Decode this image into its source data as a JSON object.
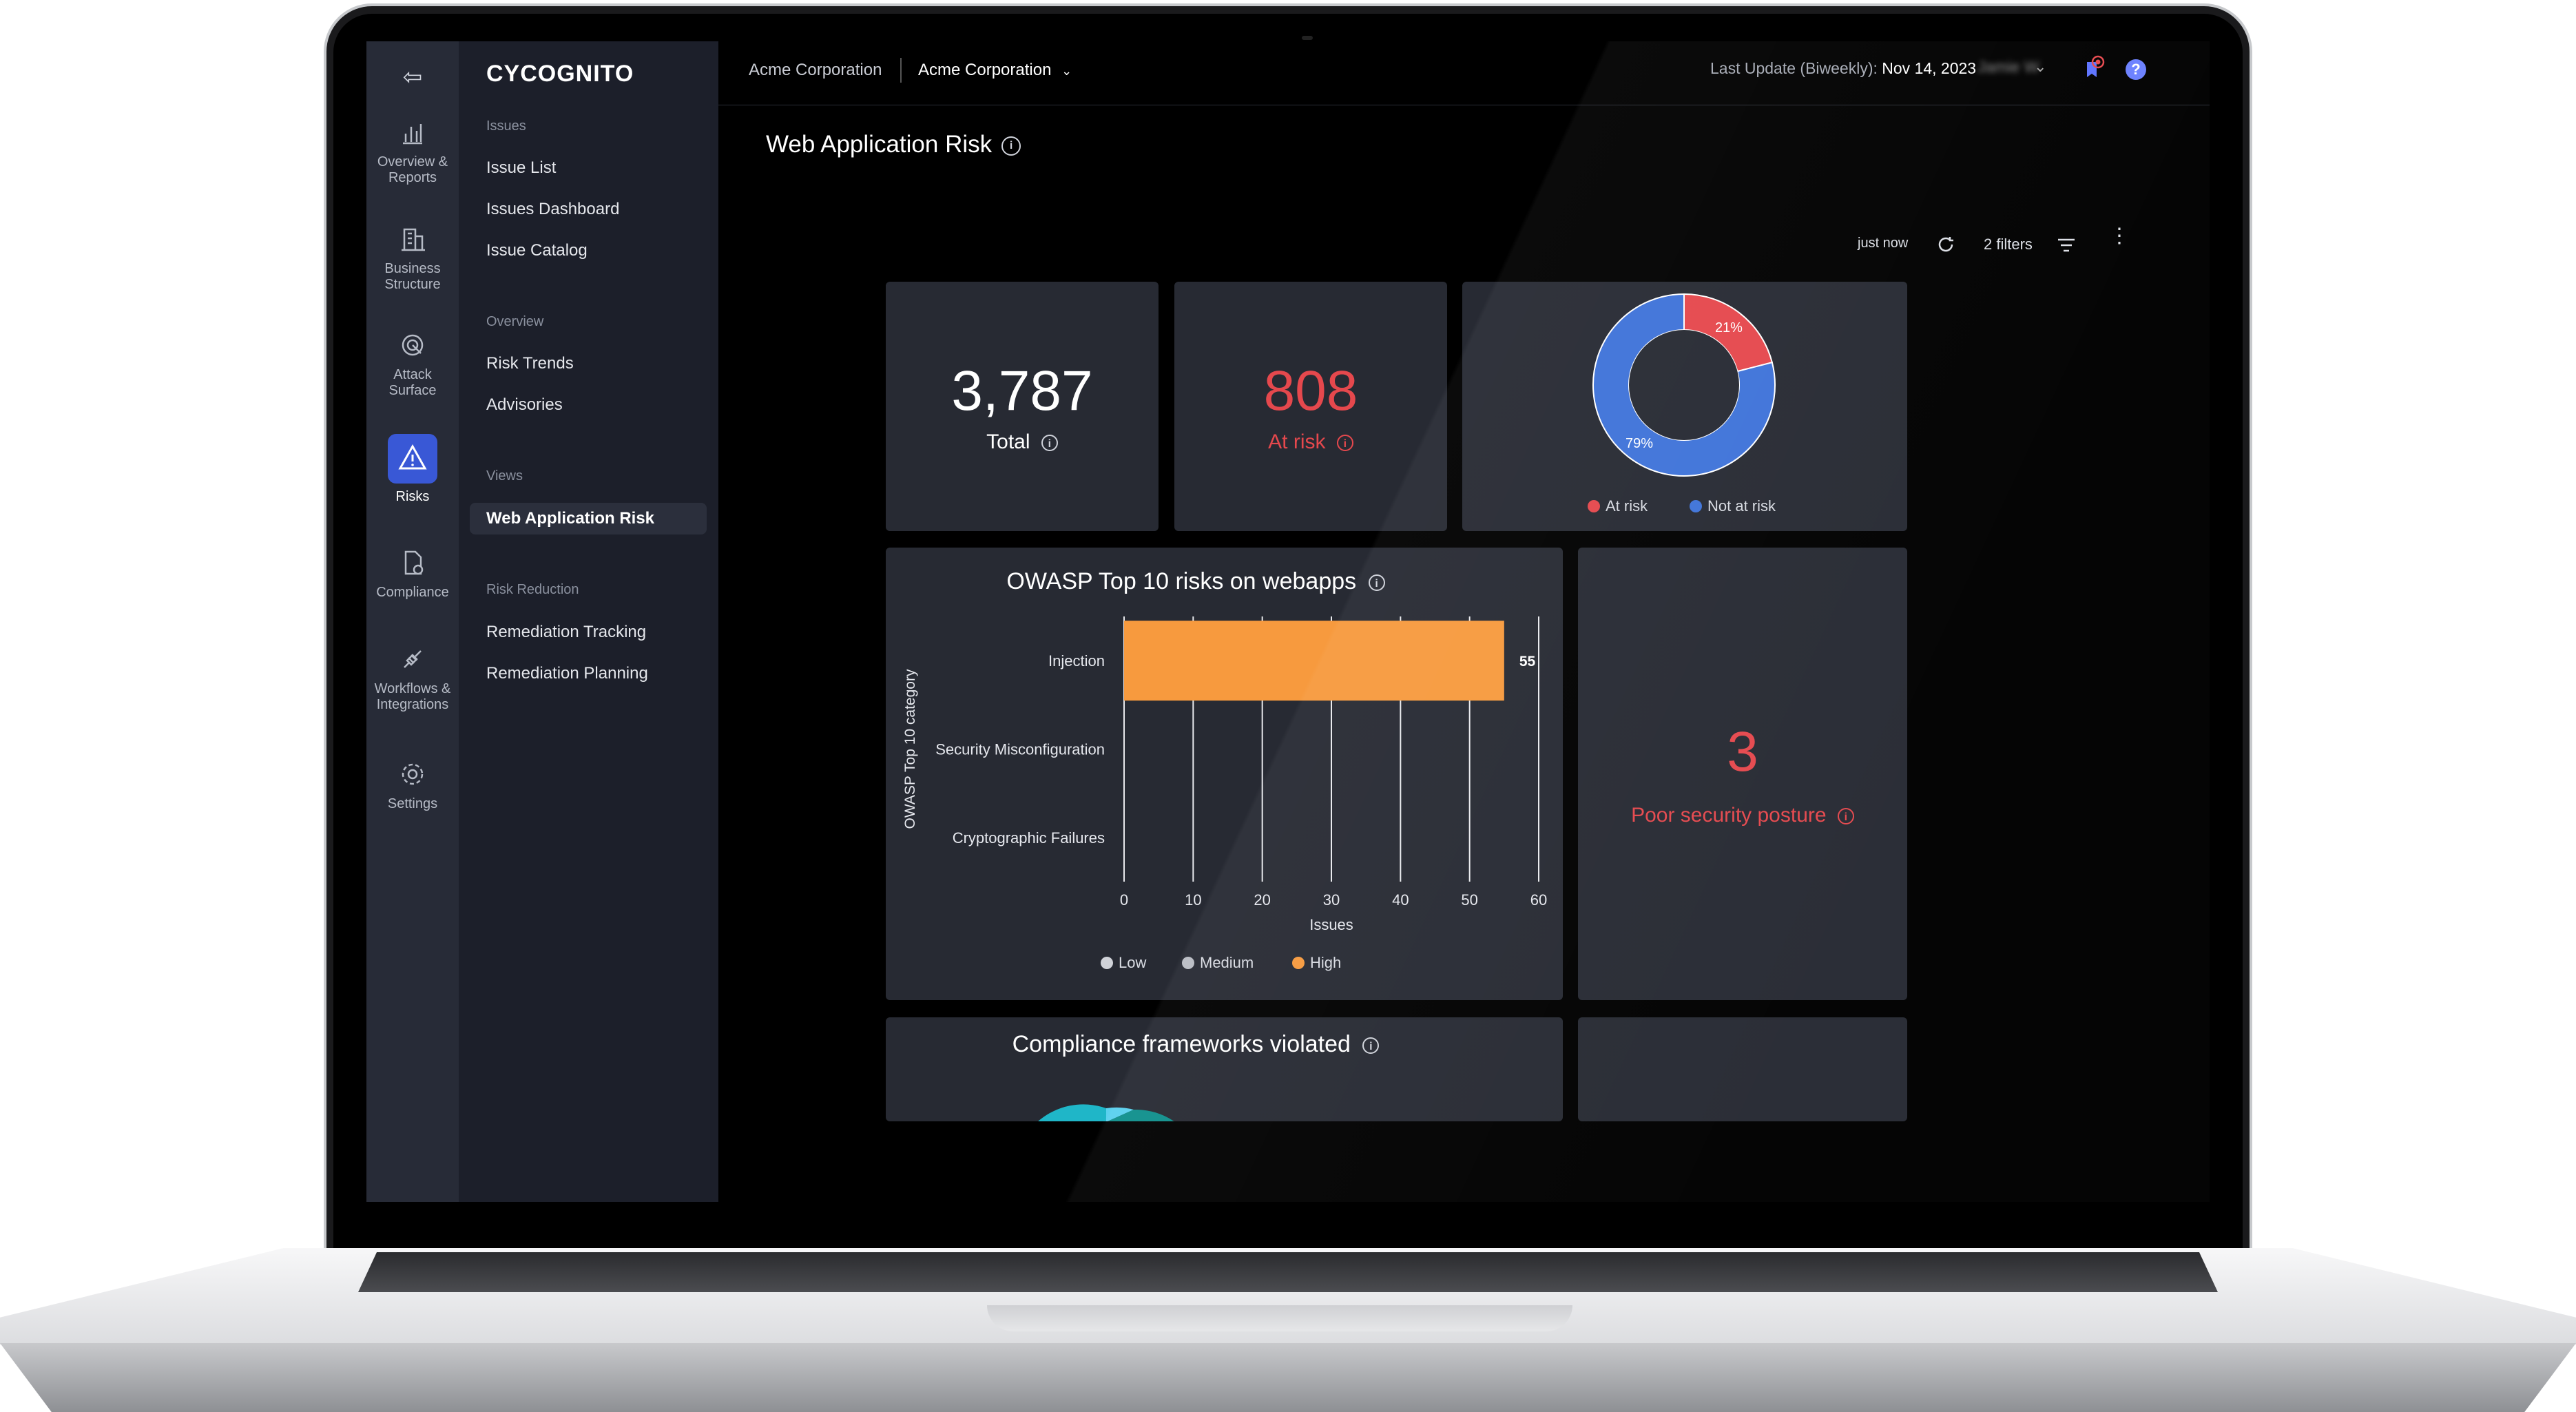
{
  "rail": {
    "items": [
      {
        "label": "Overview &\nReports"
      },
      {
        "label": "Business\nStructure"
      },
      {
        "label": "Attack\nSurface"
      },
      {
        "label": "Risks"
      },
      {
        "label": "Compliance"
      },
      {
        "label": "Workflows &\nIntegrations"
      },
      {
        "label": "Settings"
      }
    ]
  },
  "sidebar": {
    "logo": "CYCOGNITO",
    "sections": [
      {
        "title": "Issues",
        "items": [
          "Issue List",
          "Issues Dashboard",
          "Issue Catalog"
        ]
      },
      {
        "title": "Overview",
        "items": [
          "Risk Trends",
          "Advisories"
        ]
      },
      {
        "title": "Views",
        "items": [
          "Web Application Risk"
        ]
      },
      {
        "title": "Risk Reduction",
        "items": [
          "Remediation Tracking",
          "Remediation Planning"
        ]
      }
    ],
    "active_item": "Web Application Risk"
  },
  "header": {
    "org_label": "Acme Corporation",
    "org_selector": "Acme Corporation",
    "update_label": "Last Update (Biweekly):",
    "update_date": "Nov 14, 2023",
    "user_name": "Jamie W",
    "help_label": "?"
  },
  "page": {
    "title": "Web Application Risk",
    "refresh_text": "just now",
    "filters_label": "2 filters"
  },
  "kpis": {
    "total": {
      "value": "3,787",
      "label": "Total"
    },
    "at_risk": {
      "value": "808",
      "label": "At risk"
    },
    "poor_posture": {
      "value": "3",
      "label": "Poor security posture"
    }
  },
  "compliance_card": {
    "title": "Compliance frameworks violated"
  },
  "colors": {
    "accent": "#3958d6",
    "danger": "#e5484d",
    "high": "#f79a3e",
    "donut_blue": "#3f73d9",
    "donut_red": "#e5484d"
  },
  "chart_data": [
    {
      "type": "pie",
      "categories": [
        "At risk",
        "Not at risk"
      ],
      "values": [
        21,
        79
      ],
      "labels": [
        "21%",
        "79%"
      ],
      "legend_placement": "bottom"
    },
    {
      "type": "bar",
      "title": "OWASP Top 10 risks on webapps",
      "categories": [
        "Injection",
        "Security Misconfiguration",
        "Cryptographic Failures"
      ],
      "series": [
        {
          "name": "Low",
          "values": [
            0,
            0,
            0
          ],
          "color": "#d0d2d8"
        },
        {
          "name": "Medium",
          "values": [
            0,
            0,
            0
          ],
          "color": "#b9bcc4"
        },
        {
          "name": "High",
          "values": [
            55,
            0,
            0
          ],
          "color": "#f79a3e"
        }
      ],
      "data_labels": [
        "55"
      ],
      "xlabel": "Issues",
      "ylabel": "OWASP Top 10 category",
      "xlim": [
        0,
        60
      ],
      "xticks": [
        "0",
        "10",
        "20",
        "30",
        "40",
        "50",
        "60"
      ],
      "orientation": "horizontal",
      "grid": true,
      "legend_placement": "bottom"
    }
  ]
}
